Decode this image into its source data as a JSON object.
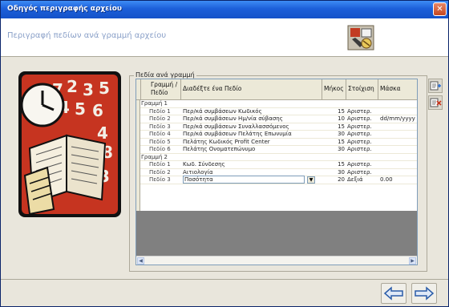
{
  "window": {
    "title": "Οδηγός περιγραφής αρχείου",
    "close_glyph": "✕"
  },
  "header": {
    "subtitle": "Περιγραφή πεδίων ανά γραμμή αρχείου",
    "icon": "wizard-tools-icon"
  },
  "group": {
    "legend": "Πεδία ανά γραμμή"
  },
  "grid": {
    "columns": {
      "row_field": "Γραμμή /Πεδίο",
      "description": "Διαδέξτε ένα Πεδίο",
      "length": "Μήκος",
      "type": "Στοίχιση",
      "mask": "Μάσκα"
    },
    "rows": [
      {
        "kind": "group",
        "label": "Γραμμή 1"
      },
      {
        "kind": "field",
        "field": "Πεδίο 1",
        "desc": "Περ/κά συμβάσεων Κωδικός",
        "len": "15",
        "type": "Αριστερ.",
        "mask": ""
      },
      {
        "kind": "field",
        "field": "Πεδίο 2",
        "desc": "Περ/κά συμβάσεων Ημ/νία σύβασης",
        "len": "10",
        "type": "Αριστερ.",
        "mask": "dd/mm/yyyy"
      },
      {
        "kind": "field",
        "field": "Πεδίο 3",
        "desc": "Περ/κά συμβάσεων Συναλλασσόμενος",
        "len": "15",
        "type": "Αριστερ.",
        "mask": ""
      },
      {
        "kind": "field",
        "field": "Πεδίο 4",
        "desc": "Περ/κά συμβάσεων Πελάτης Επωνυμία",
        "len": "30",
        "type": "Αριστερ.",
        "mask": ""
      },
      {
        "kind": "field",
        "field": "Πεδίο 5",
        "desc": "Πελάτης Κωδικός Profit Center",
        "len": "15",
        "type": "Αριστερ.",
        "mask": ""
      },
      {
        "kind": "field",
        "field": "Πεδίο 6",
        "desc": "Πελάτης Ονοματεπώνυμο",
        "len": "30",
        "type": "Αριστερ.",
        "mask": ""
      },
      {
        "kind": "group",
        "label": "Γραμμή 2"
      },
      {
        "kind": "field",
        "field": "Πεδίο 1",
        "desc": "Κωδ. Σύνδεσης",
        "len": "15",
        "type": "Αριστερ.",
        "mask": ""
      },
      {
        "kind": "field",
        "field": "Πεδίο 2",
        "desc": "Αιτιολογία",
        "len": "30",
        "type": "Αριστερ.",
        "mask": ""
      },
      {
        "kind": "field",
        "field": "Πεδίο 3",
        "desc": "Ποσότητα",
        "len": "20",
        "type": "Δεξιά",
        "mask": "0.00",
        "selected": true
      }
    ]
  },
  "side_buttons": [
    "add-field-icon",
    "delete-field-icon"
  ],
  "nav": {
    "back_glyph": "⇦",
    "next_glyph": "⇨"
  },
  "colors": {
    "titlebar": "#1c5fd9",
    "subtitle": "#8aa0c8",
    "window_bg": "#e9e6dc",
    "grid_empty": "#808080"
  }
}
